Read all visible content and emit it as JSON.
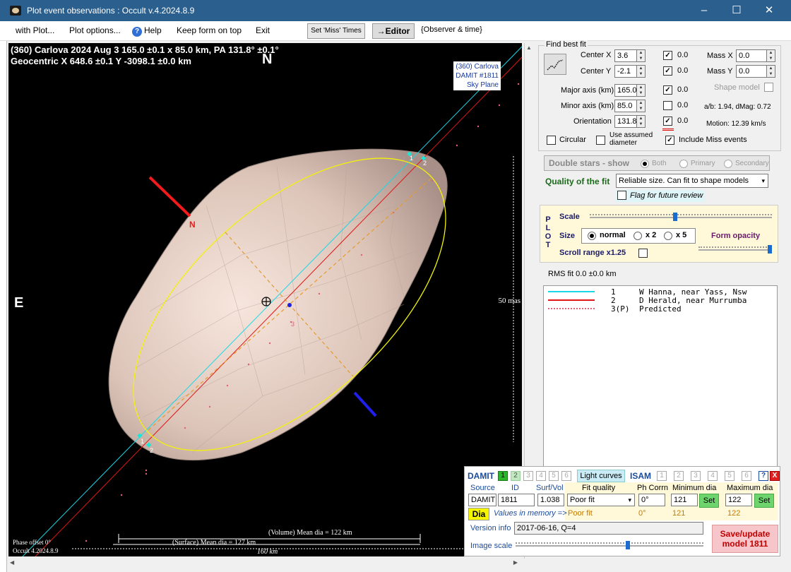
{
  "window": {
    "title": "Plot event observations : Occult v.4.2024.8.9",
    "minimize": "–",
    "maximize": "☐",
    "close": "✕"
  },
  "menu": {
    "with_plot": "with Plot...",
    "plot_options": "Plot options...",
    "help": "Help",
    "help_icon": "?",
    "keep_on_top": "Keep form on top",
    "exit": "Exit",
    "set_miss": "Set 'Miss' Times",
    "editor": "→Editor",
    "observer_time": "{Observer & time}"
  },
  "plot": {
    "header_line1": "(360) Carlova  2024 Aug 3   165.0 ±0.1 x 85.0 km, PA 131.8° ±0.1°",
    "header_line2": "Geocentric  X  648.6 ±0.1  Y -3098.1 ±0.0 km",
    "north": "N",
    "east": "E",
    "axis_n": "N",
    "sky_box": [
      "(360) Carlova",
      "DAMIT #1811",
      "Sky Plane"
    ],
    "scale_label": "50 mas",
    "volume_label": "(Volume) Mean dia = 122 km",
    "surface_label": "(Surface) Mean dia = 127 km",
    "scale_km": "160 km",
    "phase": "Phase offset 0°",
    "version": "Occult 4.2024.8.9",
    "chord_labels": {
      "a1": "1",
      "a2": "2",
      "b1": "1",
      "b2": "2",
      "pred": "3"
    }
  },
  "fit": {
    "group_title": "Find best fit",
    "center_x": {
      "label": "Center X",
      "value": "3.6",
      "checked": "✓",
      "delta": "0.0"
    },
    "center_y": {
      "label": "Center Y",
      "value": "-2.1",
      "checked": "✓",
      "delta": "0.0"
    },
    "major": {
      "label": "Major axis (km)",
      "value": "165.0",
      "checked": "✓",
      "delta": "0.0"
    },
    "minor": {
      "label": "Minor axis (km)",
      "value": "85.0",
      "checked": "",
      "delta": "0.0"
    },
    "orientation": {
      "label": "Orientation",
      "value": "131.8",
      "checked": "✓",
      "delta": "0.0"
    },
    "mass_x": {
      "label": "Mass X",
      "value": "0.0"
    },
    "mass_y": {
      "label": "Mass Y",
      "value": "0.0"
    },
    "shape_model": "Shape model",
    "ab_dmag": "a/b: 1.94, dMag: 0.72",
    "motion": "Motion: 12.39 km/s",
    "circular": "Circular",
    "use_assumed": "Use assumed diameter",
    "include_miss": "Include Miss events",
    "include_miss_checked": "✓"
  },
  "double_stars": {
    "label": "Double stars - show",
    "both": "Both",
    "primary": "Primary",
    "secondary": "Secondary"
  },
  "quality": {
    "label": "Quality of the fit",
    "value": "Reliable size. Can fit to shape models",
    "flag": "Flag for future review"
  },
  "plot_panel": {
    "letters": [
      "P",
      "L",
      "O",
      "T"
    ],
    "scale": "Scale",
    "size": "Size",
    "normal": "normal",
    "x2": "x 2",
    "x5": "x 5",
    "form_opacity": "Form opacity",
    "scroll_range": "Scroll range x1.25",
    "scale_level": 0.47,
    "opacity_level": 1.0
  },
  "rms": "RMS fit 0.0 ±0.0 km",
  "legend": [
    {
      "num": "1",
      "name": "W Hanna, near Yass, Nsw",
      "color": "#18d8e8",
      "style": "solid"
    },
    {
      "num": "2",
      "name": "D Herald, near Murrumba",
      "color": "#e01515",
      "style": "solid"
    },
    {
      "num": "3(P)",
      "name": "Predicted",
      "color": "#e0607a",
      "style": "dots"
    }
  ],
  "damit": {
    "title": "DAMIT",
    "tabs": [
      "1",
      "2",
      "3",
      "4",
      "5",
      "6"
    ],
    "light_curves": "Light curves",
    "isam": "ISAM",
    "isam_tabs": [
      "1",
      "2",
      "3",
      "4",
      "5",
      "6"
    ],
    "help": "?",
    "close": "X",
    "source_label": "Source",
    "id_label": "ID",
    "surf_label": "Surf/Vol",
    "source": "DAMIT",
    "id": "1811",
    "surf": "1.038",
    "fit_quality_label": "Fit quality",
    "fit_quality": "Poor fit",
    "ph_corr_label": "Ph Corrn",
    "ph_corr": "0°",
    "min_dia_label": "Minimum dia",
    "min_dia": "121",
    "max_dia_label": "Maximum dia",
    "max_dia": "122",
    "set": "Set",
    "dia": "Dia",
    "values_in_memory": "Values in memory =>",
    "mem_fit": "Poor fit",
    "mem_ph": "0°",
    "mem_min": "121",
    "mem_max": "122",
    "version_label": "Version info",
    "version": "2017-06-16, Q=4",
    "image_scale": "Image scale",
    "image_scale_level": 0.6,
    "save_line1": "Save/update",
    "save_line2": "model 1811"
  }
}
